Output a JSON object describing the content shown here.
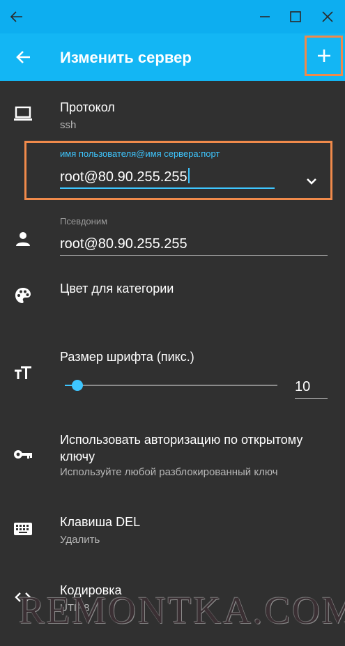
{
  "window": {
    "back_icon": "arrow-left-icon",
    "minimize_icon": "minimize-icon",
    "maximize_icon": "maximize-icon",
    "close_icon": "close-icon",
    "titlebar_color": "#0daef0"
  },
  "appbar": {
    "title": "Изменить сервер",
    "back_icon": "arrow-left-icon",
    "add_icon": "plus-icon",
    "color": "#13b6f4",
    "highlight_color": "#f08a4b"
  },
  "protocol": {
    "icon": "laptop-icon",
    "label": "Протокол",
    "value": "ssh"
  },
  "address": {
    "label": "имя пользователя@имя сервера:порт",
    "value": "root@80.90.255.255",
    "dropdown_icon": "chevron-down-icon",
    "accent_color": "#3ec6ff"
  },
  "nickname": {
    "icon": "person-icon",
    "label": "Псевдоним",
    "value": "root@80.90.255.255"
  },
  "category_color": {
    "icon": "palette-icon",
    "label": "Цвет для категории"
  },
  "font_size": {
    "icon": "text-size-icon",
    "label": "Размер шрифта (пикс.)",
    "slider_fraction": 0.06,
    "value": "10"
  },
  "pubkey": {
    "icon": "key-icon",
    "label_line1": "Использовать авторизацию по открытому",
    "label_line2": "ключу",
    "sub": "Используйте любой разблокированный ключ"
  },
  "del_key": {
    "icon": "keyboard-icon",
    "label": "Клавиша DEL",
    "value": "Удалить"
  },
  "encoding": {
    "icon": "code-icon",
    "label": "Кодировка",
    "value": "UTF-8"
  },
  "watermark": "REMONTKA.COM"
}
